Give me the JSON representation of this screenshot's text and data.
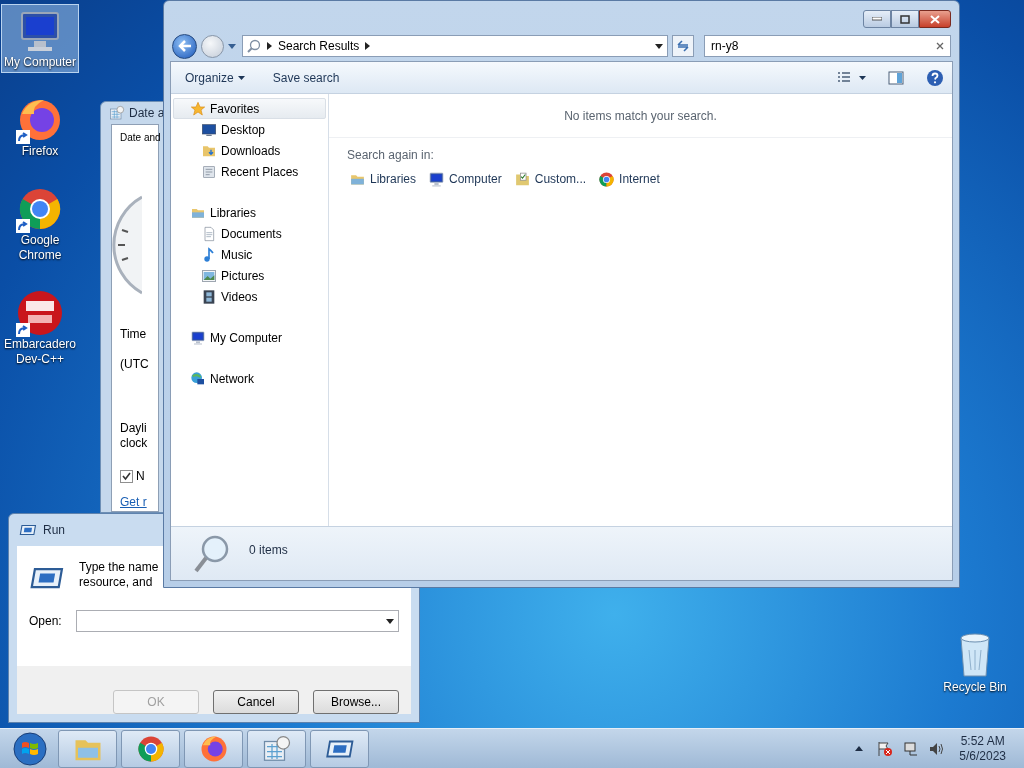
{
  "desktop_icons": [
    {
      "label": "My Computer",
      "kind": "computer",
      "selected": true
    },
    {
      "label": "Firefox",
      "kind": "firefox",
      "selected": false
    },
    {
      "label": "Google Chrome",
      "kind": "chrome",
      "selected": false
    },
    {
      "label": "Embarcadero Dev-C++",
      "kind": "devcpp",
      "selected": false
    }
  ],
  "recycle_bin": {
    "label": "Recycle Bin"
  },
  "date_window": {
    "title": "Date a",
    "tab": "Date and",
    "time_zone_heading": "Time",
    "time_zone": "(UTC",
    "dst_lines": [
      "Dayli",
      "clock"
    ],
    "checkbox": {
      "label": "N",
      "checked": true
    },
    "link": "Get r"
  },
  "run_dialog": {
    "title": "Run",
    "description_lines": [
      "Type the name",
      "resource, and"
    ],
    "open_label": "Open:",
    "buttons": [
      {
        "label": "OK",
        "disabled": true
      },
      {
        "label": "Cancel",
        "disabled": false
      },
      {
        "label": "Browse...",
        "disabled": false
      }
    ]
  },
  "explorer": {
    "address": "Search Results",
    "search_value": "rn-y8",
    "toolbar": [
      "Organize",
      "Save search"
    ],
    "sidebar": [
      {
        "label": "Favorites",
        "kind": "star",
        "selected": true,
        "children": [
          {
            "label": "Desktop",
            "kind": "desktop"
          },
          {
            "label": "Downloads",
            "kind": "downloads"
          },
          {
            "label": "Recent Places",
            "kind": "recent"
          }
        ]
      },
      {
        "label": "Libraries",
        "kind": "library",
        "selected": false,
        "children": [
          {
            "label": "Documents",
            "kind": "document"
          },
          {
            "label": "Music",
            "kind": "music"
          },
          {
            "label": "Pictures",
            "kind": "picture"
          },
          {
            "label": "Videos",
            "kind": "video"
          }
        ]
      },
      {
        "label": "My Computer",
        "kind": "computer",
        "selected": false
      },
      {
        "label": "Network",
        "kind": "network",
        "selected": false
      }
    ],
    "message": "No items match your search.",
    "search_again_label": "Search again in:",
    "search_again": [
      {
        "label": "Libraries",
        "kind": "library"
      },
      {
        "label": "Computer",
        "kind": "computer"
      },
      {
        "label": "Custom...",
        "kind": "custom"
      },
      {
        "label": "Internet",
        "kind": "chrome"
      }
    ],
    "status": "0 items"
  },
  "taskbar": {
    "buttons": [
      {
        "kind": "folder"
      },
      {
        "kind": "chrome"
      },
      {
        "kind": "firefox"
      },
      {
        "kind": "calendar"
      },
      {
        "kind": "run"
      }
    ],
    "time": "5:52 AM",
    "date": "5/6/2023"
  }
}
